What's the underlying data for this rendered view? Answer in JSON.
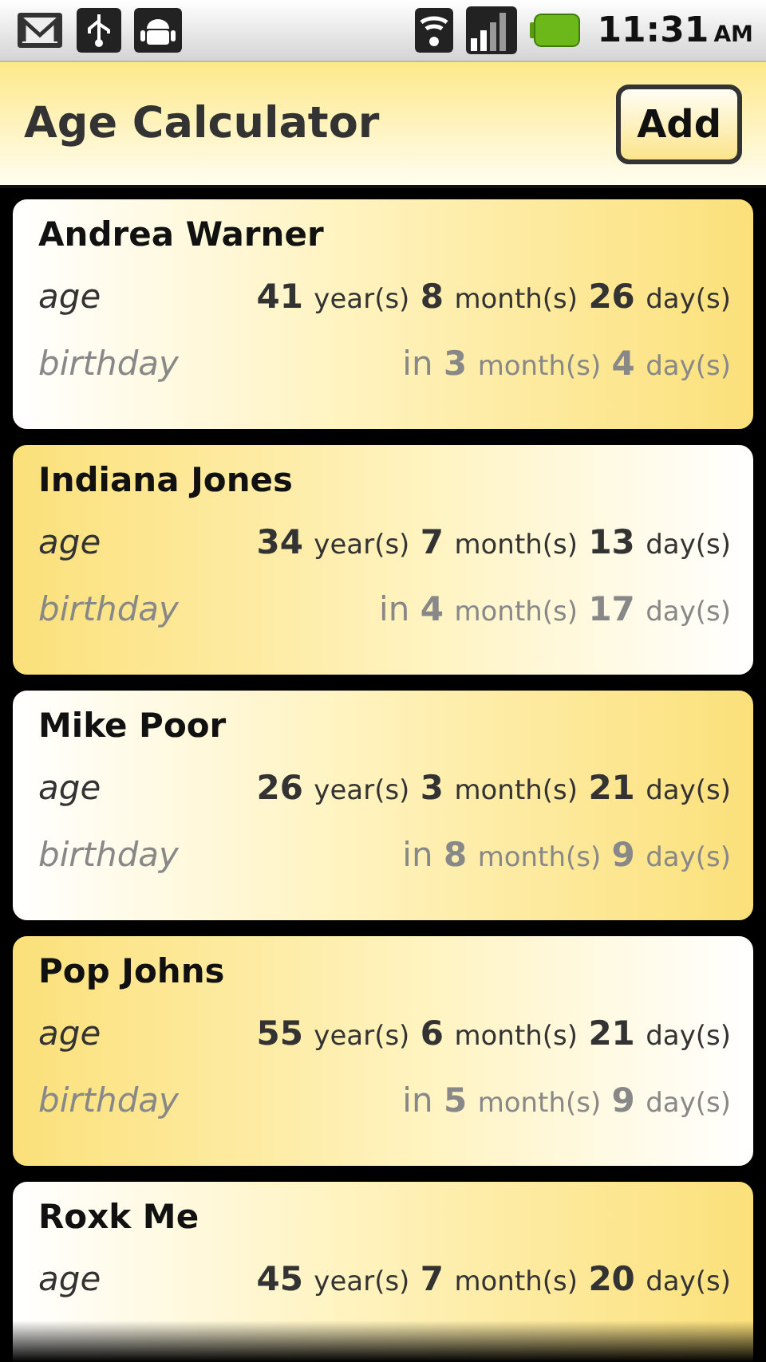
{
  "status_bar": {
    "time": "11:31",
    "ampm": "AM"
  },
  "app_bar": {
    "title": "Age Calculator",
    "button": "Add"
  },
  "people": [
    {
      "name": "Andrea Warner",
      "age_label": "age",
      "age": [
        {
          "number": "41",
          "unit": "year(s)"
        },
        {
          "number": "8",
          "unit": "month(s)"
        },
        {
          "number": "26",
          "unit": "day(s)"
        }
      ],
      "birthday_label": "birthday",
      "birthday_prefix": "in",
      "birthday": [
        {
          "number": "3",
          "unit": "month(s)"
        },
        {
          "number": "4",
          "unit": "day(s)"
        }
      ]
    },
    {
      "name": "Indiana Jones",
      "age_label": "age",
      "age": [
        {
          "number": "34",
          "unit": "year(s)"
        },
        {
          "number": "7",
          "unit": "month(s)"
        },
        {
          "number": "13",
          "unit": "day(s)"
        }
      ],
      "birthday_label": "birthday",
      "birthday_prefix": "in",
      "birthday": [
        {
          "number": "4",
          "unit": "month(s)"
        },
        {
          "number": "17",
          "unit": "day(s)"
        }
      ]
    },
    {
      "name": "Mike Poor",
      "age_label": "age",
      "age": [
        {
          "number": "26",
          "unit": "year(s)"
        },
        {
          "number": "3",
          "unit": "month(s)"
        },
        {
          "number": "21",
          "unit": "day(s)"
        }
      ],
      "birthday_label": "birthday",
      "birthday_prefix": "in",
      "birthday": [
        {
          "number": "8",
          "unit": "month(s)"
        },
        {
          "number": "9",
          "unit": "day(s)"
        }
      ]
    },
    {
      "name": "Pop Johns",
      "age_label": "age",
      "age": [
        {
          "number": "55",
          "unit": "year(s)"
        },
        {
          "number": "6",
          "unit": "month(s)"
        },
        {
          "number": "21",
          "unit": "day(s)"
        }
      ],
      "birthday_label": "birthday",
      "birthday_prefix": "in",
      "birthday": [
        {
          "number": "5",
          "unit": "month(s)"
        },
        {
          "number": "9",
          "unit": "day(s)"
        }
      ]
    },
    {
      "name": "Roxk Me",
      "age_label": "age",
      "age": [
        {
          "number": "45",
          "unit": "year(s)"
        },
        {
          "number": "7",
          "unit": "month(s)"
        },
        {
          "number": "20",
          "unit": "day(s)"
        }
      ]
    }
  ]
}
